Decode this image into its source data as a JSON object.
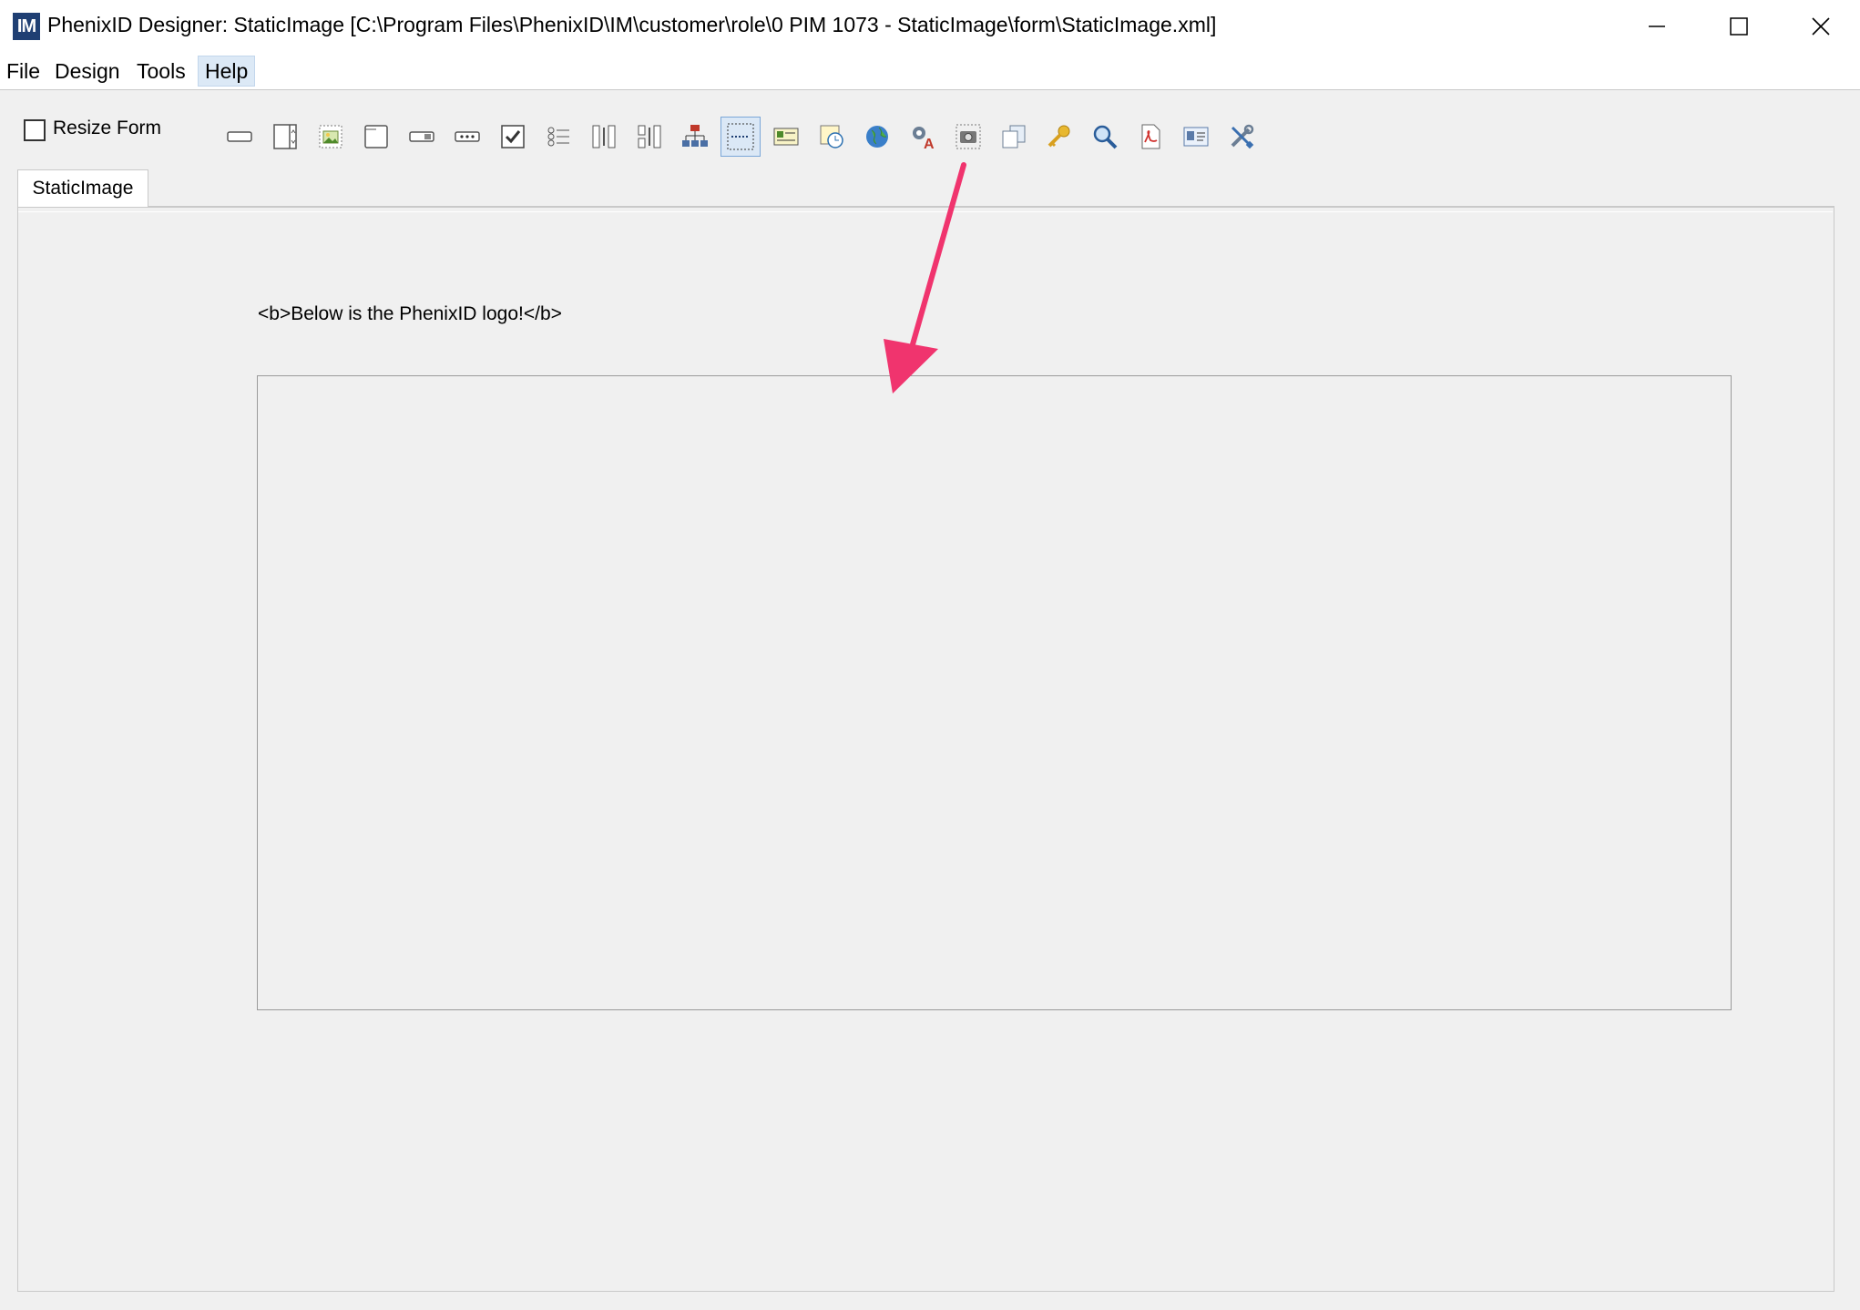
{
  "window": {
    "title": "PhenixID Designer: StaticImage [C:\\Program Files\\PhenixID\\IM\\customer\\role\\0 PIM 1073 - StaticImage\\form\\StaticImage.xml]",
    "app_icon_text": "IM"
  },
  "menu": {
    "file": "File",
    "design": "Design",
    "tools": "Tools",
    "help": "Help"
  },
  "toolbar": {
    "resize_form_label": "Resize Form",
    "resize_form_checked": false,
    "tools": [
      "textfield-icon",
      "panel-icon",
      "image-icon",
      "blank-panel-icon",
      "combobox-icon",
      "password-field-icon",
      "checkbox-icon",
      "radio-list-icon",
      "column-icon",
      "split-column-icon",
      "tree-icon",
      "separator-icon",
      "label-card-icon",
      "world-clock-icon",
      "globe-icon",
      "gear-text-icon",
      "camera-icon",
      "copy-pages-icon",
      "key-icon",
      "search-icon",
      "pdf-icon",
      "id-card-icon",
      "tools-icon"
    ],
    "selected_tool": "separator-icon"
  },
  "tabs": [
    {
      "label": "StaticImage"
    }
  ],
  "form": {
    "static_text": "<b>Below is the PhenixID logo!</b>"
  },
  "annotation": {
    "arrow_color": "#f0346e"
  }
}
